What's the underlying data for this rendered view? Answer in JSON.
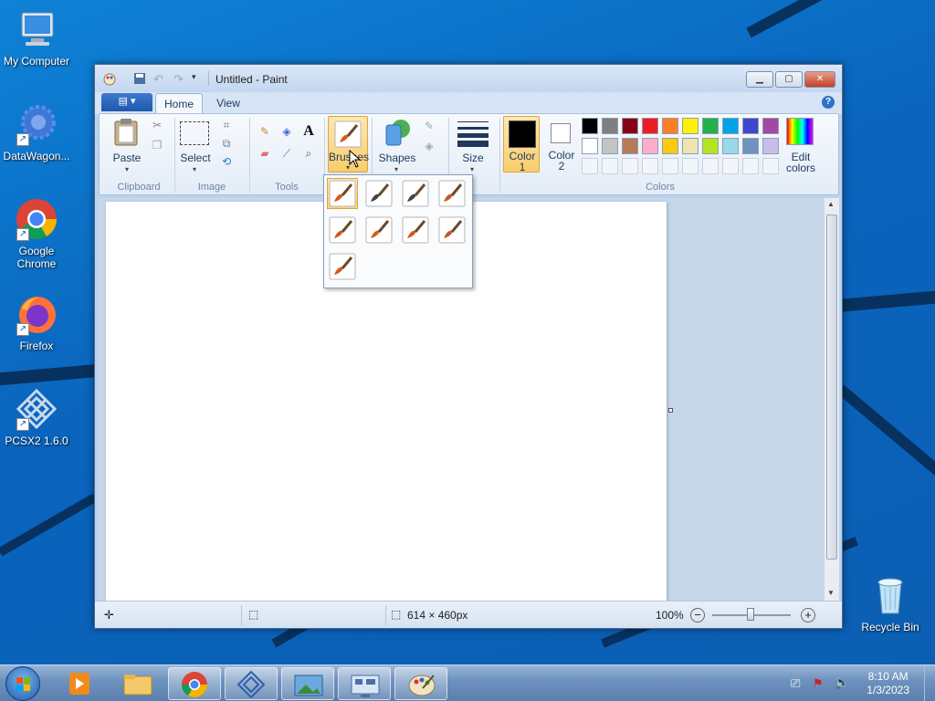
{
  "desktop": {
    "icons": [
      {
        "label": "My Computer"
      },
      {
        "label": "DataWagon..."
      },
      {
        "label": "Google Chrome"
      },
      {
        "label": "Firefox"
      },
      {
        "label": "PCSX2 1.6.0"
      },
      {
        "label": "Recycle Bin"
      }
    ]
  },
  "window": {
    "title": "Untitled - Paint",
    "tabs": {
      "home": "Home",
      "view": "View"
    },
    "ribbon": {
      "clipboard": {
        "paste": "Paste",
        "group": "Clipboard"
      },
      "image": {
        "select": "Select",
        "group": "Image"
      },
      "tools": {
        "group": "Tools",
        "text_glyph": "A"
      },
      "brushes": {
        "label": "Brushes"
      },
      "shapes": {
        "label": "Shapes"
      },
      "size": {
        "label": "Size"
      },
      "colors": {
        "color1_line1": "Color",
        "color1_line2": "1",
        "color2_line1": "Color",
        "color2_line2": "2",
        "edit_line1": "Edit",
        "edit_line2": "colors",
        "group": "Colors",
        "color1": "#000000",
        "color2": "#ffffff",
        "palette_row1": [
          "#000000",
          "#7f7f7f",
          "#880015",
          "#ed1c24",
          "#ff7f27",
          "#fff200",
          "#22b14c",
          "#00a2e8",
          "#3f48cc",
          "#a349a4"
        ],
        "palette_row2": [
          "#ffffff",
          "#c3c3c3",
          "#b97a57",
          "#ffaec9",
          "#ffc90e",
          "#efe4b0",
          "#b5e61d",
          "#99d9ea",
          "#7092be",
          "#c8bfe7"
        ]
      }
    },
    "status": {
      "canvas_size": "614 × 460px",
      "zoom": "100%"
    }
  },
  "taskbar": {
    "time": "8:10 AM",
    "date": "1/3/2023"
  }
}
